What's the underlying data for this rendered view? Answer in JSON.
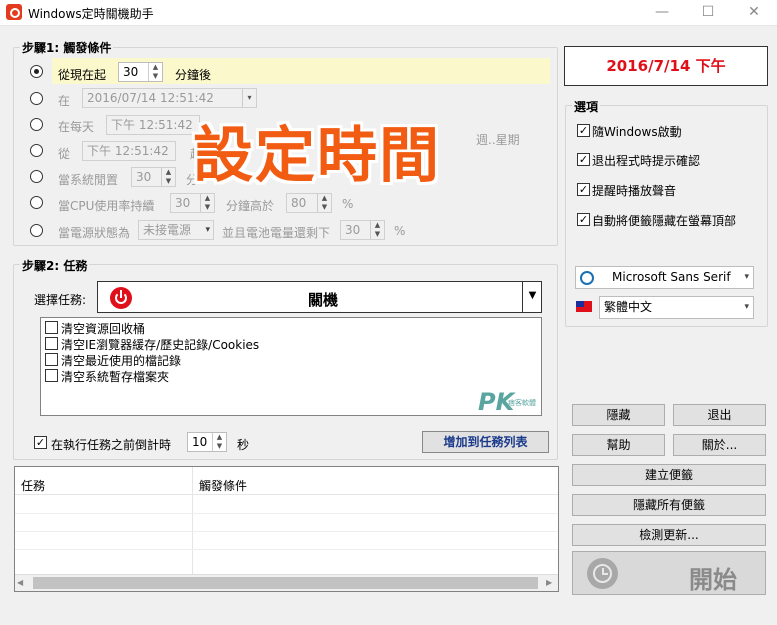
{
  "window": {
    "title": "Windows定時關機助手",
    "minimize": "—",
    "maximize": "☐",
    "close": "✕"
  },
  "step1": {
    "title": "步驟1: 觸發條件",
    "row1": {
      "label": "從現在起",
      "value": "30",
      "unit": "分鐘後"
    },
    "row2": {
      "label": "在",
      "value": "2016/07/14   12:51:42"
    },
    "row3": {
      "label": "在每天",
      "value": "下午 12:51:42",
      "suffix": "週..星期"
    },
    "row4": {
      "label": "從",
      "value": "下午 12:51:42",
      "suffix": "起"
    },
    "row5": {
      "label": "當系統閒置",
      "value": "30",
      "unit": "分"
    },
    "row6": {
      "label": "當CPU使用率持續",
      "value": "30",
      "mid": "分鐘高於",
      "value2": "80",
      "unit": "%"
    },
    "row7": {
      "label": "當電源狀態為",
      "select": "未接電源",
      "mid": "並且電池電量還剩下",
      "value": "30",
      "unit": "%"
    }
  },
  "overlay": "設定時間",
  "date_display": "2016/7/14 下午",
  "options": {
    "title": "選項",
    "items": [
      "隨Windows啟動",
      "退出程式時提示確認",
      "提醒時播放聲音",
      "自動將便籤隱藏在螢幕頂部"
    ],
    "font_select": "Microsoft Sans Serif",
    "language_select": "繁體中文"
  },
  "step2": {
    "title": "步驟2: 任務",
    "select_label": "選擇任務:",
    "task_value": "關機",
    "subtasks": [
      "清空資源回收桶",
      "清空IE瀏覽器緩存/歷史記錄/Cookies",
      "清空最近使用的檔記錄",
      "清空系統暫存檔案夾"
    ],
    "countdown_label": "在執行任務之前倒計時",
    "countdown_value": "10",
    "countdown_unit": "秒",
    "add_button": "增加到任務列表"
  },
  "watermark": {
    "big": "PK",
    "small": "痞客軟體"
  },
  "task_table": {
    "columns": [
      "任務",
      "觸發條件"
    ]
  },
  "buttons": {
    "hide": "隱藏",
    "exit": "退出",
    "help": "幫助",
    "about": "關於...",
    "create_note": "建立便籤",
    "hide_all_notes": "隱藏所有便籤",
    "check_update": "檢測更新...",
    "start": "開始"
  }
}
